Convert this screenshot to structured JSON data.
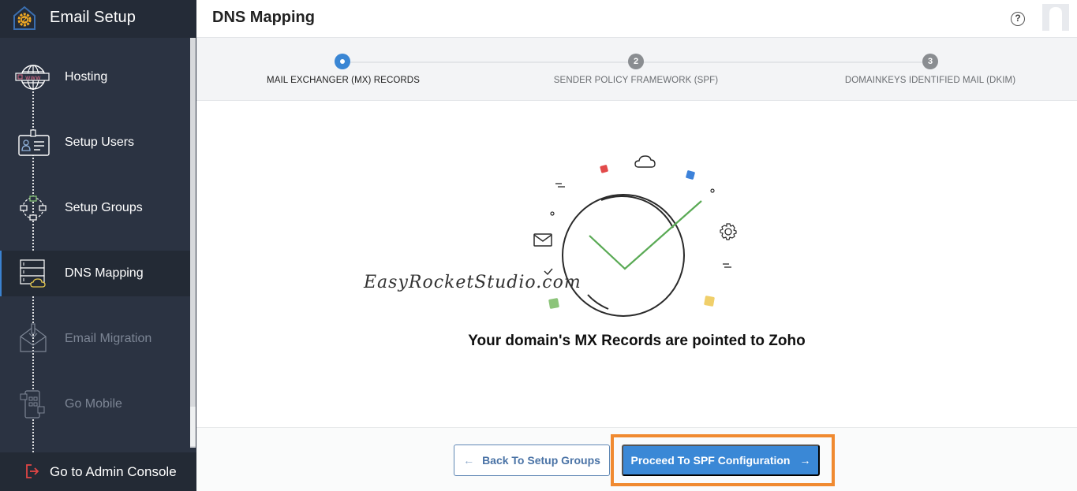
{
  "sidebar": {
    "title": "Email Setup",
    "logo_icon": "gear-house-icon",
    "items": [
      {
        "label": "Hosting",
        "icon": "globe-www-icon",
        "state": "done"
      },
      {
        "label": "Setup Users",
        "icon": "id-card-icon",
        "state": "done"
      },
      {
        "label": "Setup Groups",
        "icon": "group-network-icon",
        "state": "done"
      },
      {
        "label": "DNS Mapping",
        "icon": "server-cloud-icon",
        "state": "active"
      },
      {
        "label": "Email Migration",
        "icon": "email-download-icon",
        "state": "disabled"
      },
      {
        "label": "Go Mobile",
        "icon": "mobile-apps-icon",
        "state": "disabled"
      }
    ],
    "footer_label": "Go to Admin Console",
    "footer_icon": "exit-icon"
  },
  "header": {
    "title": "DNS Mapping",
    "help_icon": "?",
    "avatar": "user-avatar"
  },
  "stepper": {
    "steps": [
      {
        "number": "1",
        "label": "MAIL EXCHANGER (MX) RECORDS",
        "active": true
      },
      {
        "number": "2",
        "label": "SENDER POLICY FRAMEWORK (SPF)",
        "active": false
      },
      {
        "number": "3",
        "label": "DOMAINKEYS IDENTIFIED MAIL (DKIM)",
        "active": false
      }
    ]
  },
  "main": {
    "watermark": "EasyRocketStudio.com",
    "message": "Your domain's MX Records are pointed to Zoho"
  },
  "footer": {
    "back_label": "Back To Setup Groups",
    "back_arrow": "←",
    "proceed_label": "Proceed To SPF Configuration",
    "proceed_arrow": "→"
  },
  "colors": {
    "accent": "#3a88d6",
    "highlight": "#f08a30",
    "success": "#5aaa55",
    "sidebar_bg": "#2b3342"
  }
}
